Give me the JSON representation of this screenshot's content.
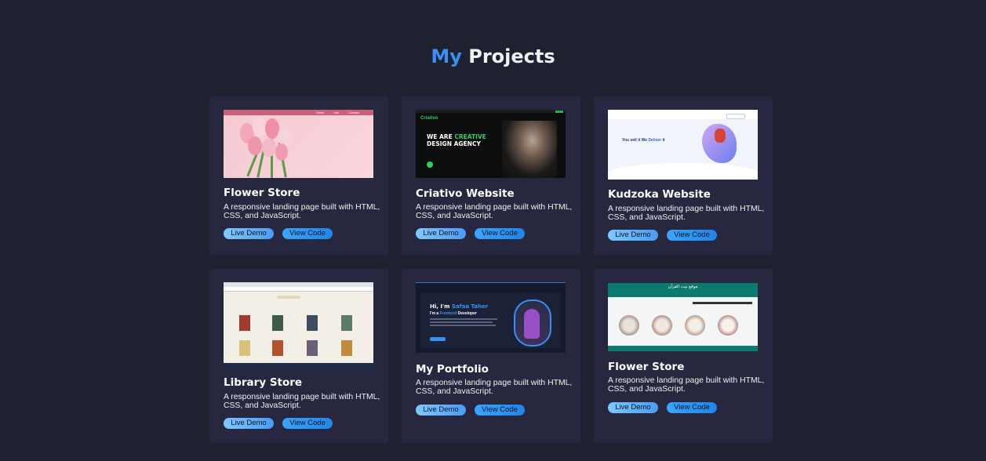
{
  "section": {
    "title_accent": "My",
    "title_rest": "Projects"
  },
  "projects": [
    {
      "title": "Flower Store",
      "description": "A responsive landing page built with HTML, CSS, and JavaScript.",
      "live_label": "Live Demo",
      "code_label": "View Code",
      "preview": {
        "nav": [
          "Home",
          "Info",
          "Contact"
        ]
      }
    },
    {
      "title": "Criativo Website",
      "description": "A responsive landing page built with HTML, CSS, and JavaScript.",
      "live_label": "Live Demo",
      "code_label": "View Code",
      "preview": {
        "brand": "Criativo",
        "headline_1": "WE ARE",
        "headline_accent": "CREATIVE",
        "headline_2": "DESIGN AGENCY"
      }
    },
    {
      "title": "Kudzoka Website",
      "description": "A responsive landing page built with HTML, CSS, and JavaScript.",
      "live_label": "Live Demo",
      "code_label": "View Code",
      "preview": {
        "tagline_1": "You sell it We",
        "tagline_accent": "Deliver",
        "tagline_2": "it"
      }
    },
    {
      "title": "Library Store",
      "description": "A responsive landing page built with HTML, CSS, and JavaScript.",
      "live_label": "Live Demo",
      "code_label": "View Code",
      "preview": {}
    },
    {
      "title": "My Portfolio",
      "description": "A responsive landing page built with HTML, CSS, and JavaScript.",
      "live_label": "Live Demo",
      "code_label": "View Code",
      "preview": {
        "greeting": "Hi, I'm",
        "name": "Safaa Taher",
        "role_1": "I'm a",
        "role_accent": "Frontend",
        "role_2": "Developer"
      }
    },
    {
      "title": "Flower Store",
      "description": "A responsive landing page built with HTML, CSS, and JavaScript.",
      "live_label": "Live Demo",
      "code_label": "View Code",
      "preview": {
        "site_title": "موقع بيت القرآن"
      }
    }
  ],
  "colors": {
    "background": "#1e2230",
    "card": "#272840",
    "accent": "#3b8ff0",
    "button_light": "#7dc8ff",
    "button_dark": "#1f86e8"
  }
}
